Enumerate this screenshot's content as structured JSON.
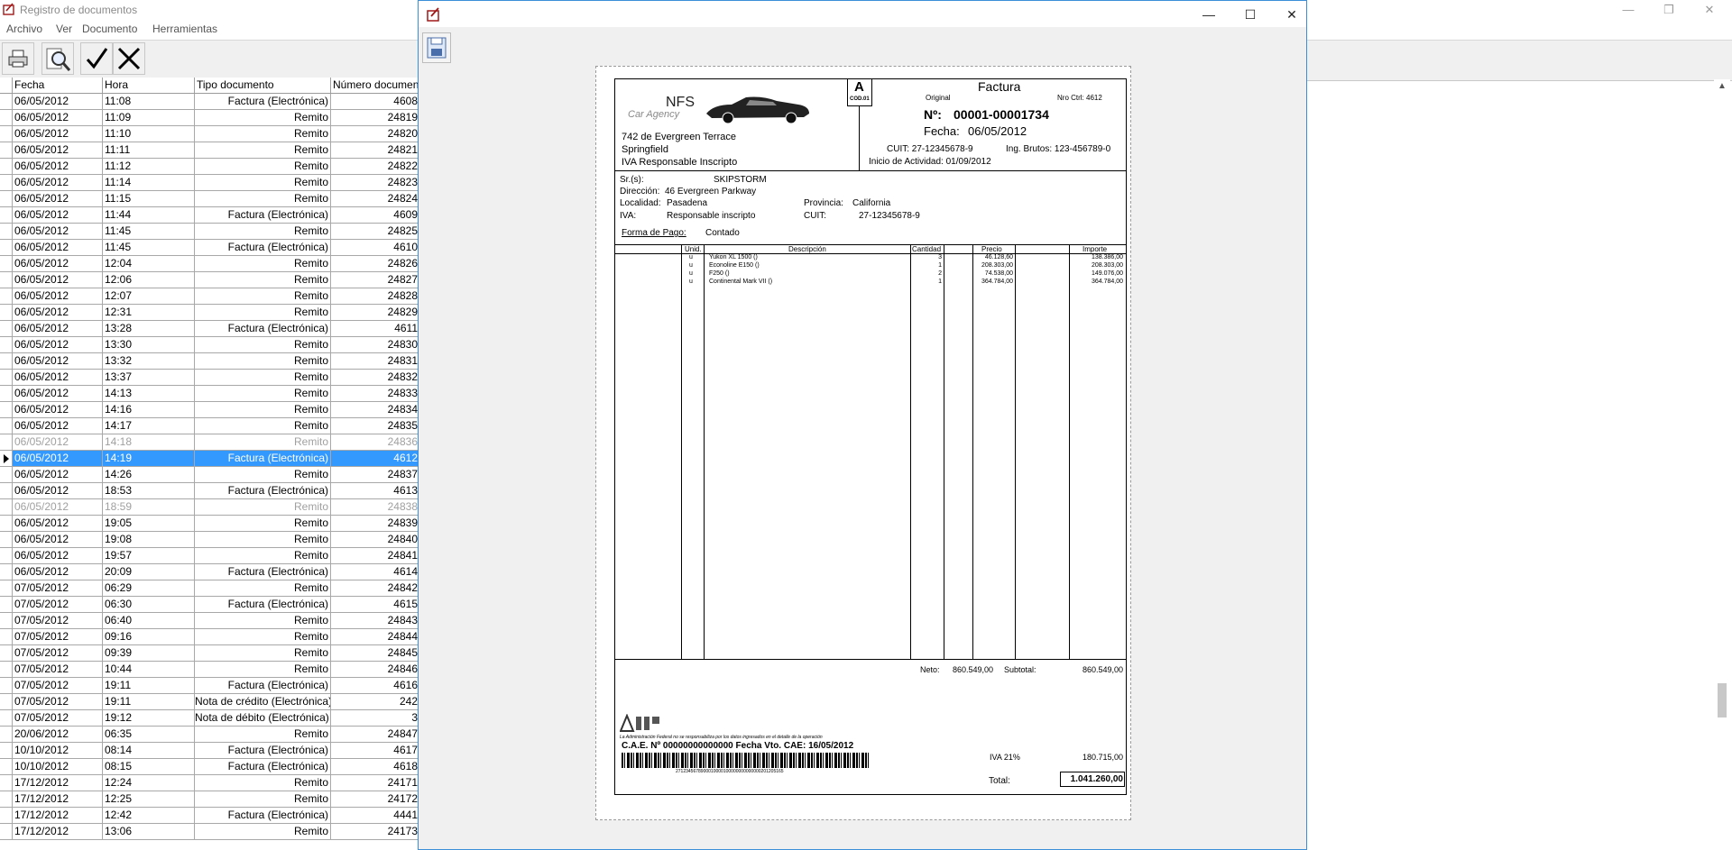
{
  "app": {
    "title": "Registro de documentos",
    "menu": [
      "Archivo",
      "Ver",
      "Documento",
      "Herramientas"
    ],
    "toolbar": [
      "printer-icon",
      "search-icon",
      "check-icon",
      "close-x-icon"
    ],
    "window_controls": [
      "—",
      "❐",
      "✕"
    ]
  },
  "grid": {
    "columns": [
      "Fecha",
      "Hora",
      "Tipo documento",
      "Número documento"
    ],
    "rows": [
      {
        "fecha": "06/05/2012",
        "hora": "11:08",
        "tipo": "Factura (Electrónica)",
        "num": "4608"
      },
      {
        "fecha": "06/05/2012",
        "hora": "11:09",
        "tipo": "Remito",
        "num": "24819"
      },
      {
        "fecha": "06/05/2012",
        "hora": "11:10",
        "tipo": "Remito",
        "num": "24820"
      },
      {
        "fecha": "06/05/2012",
        "hora": "11:11",
        "tipo": "Remito",
        "num": "24821"
      },
      {
        "fecha": "06/05/2012",
        "hora": "11:12",
        "tipo": "Remito",
        "num": "24822"
      },
      {
        "fecha": "06/05/2012",
        "hora": "11:14",
        "tipo": "Remito",
        "num": "24823"
      },
      {
        "fecha": "06/05/2012",
        "hora": "11:15",
        "tipo": "Remito",
        "num": "24824"
      },
      {
        "fecha": "06/05/2012",
        "hora": "11:44",
        "tipo": "Factura (Electrónica)",
        "num": "4609"
      },
      {
        "fecha": "06/05/2012",
        "hora": "11:45",
        "tipo": "Remito",
        "num": "24825"
      },
      {
        "fecha": "06/05/2012",
        "hora": "11:45",
        "tipo": "Factura (Electrónica)",
        "num": "4610"
      },
      {
        "fecha": "06/05/2012",
        "hora": "12:04",
        "tipo": "Remito",
        "num": "24826"
      },
      {
        "fecha": "06/05/2012",
        "hora": "12:06",
        "tipo": "Remito",
        "num": "24827"
      },
      {
        "fecha": "06/05/2012",
        "hora": "12:07",
        "tipo": "Remito",
        "num": "24828"
      },
      {
        "fecha": "06/05/2012",
        "hora": "12:31",
        "tipo": "Remito",
        "num": "24829"
      },
      {
        "fecha": "06/05/2012",
        "hora": "13:28",
        "tipo": "Factura (Electrónica)",
        "num": "4611"
      },
      {
        "fecha": "06/05/2012",
        "hora": "13:30",
        "tipo": "Remito",
        "num": "24830"
      },
      {
        "fecha": "06/05/2012",
        "hora": "13:32",
        "tipo": "Remito",
        "num": "24831"
      },
      {
        "fecha": "06/05/2012",
        "hora": "13:37",
        "tipo": "Remito",
        "num": "24832"
      },
      {
        "fecha": "06/05/2012",
        "hora": "14:13",
        "tipo": "Remito",
        "num": "24833"
      },
      {
        "fecha": "06/05/2012",
        "hora": "14:16",
        "tipo": "Remito",
        "num": "24834"
      },
      {
        "fecha": "06/05/2012",
        "hora": "14:17",
        "tipo": "Remito",
        "num": "24835"
      },
      {
        "fecha": "06/05/2012",
        "hora": "14:18",
        "tipo": "Remito",
        "num": "24836",
        "state": "dim"
      },
      {
        "fecha": "06/05/2012",
        "hora": "14:19",
        "tipo": "Factura (Electrónica)",
        "num": "4612",
        "state": "sel"
      },
      {
        "fecha": "06/05/2012",
        "hora": "14:26",
        "tipo": "Remito",
        "num": "24837"
      },
      {
        "fecha": "06/05/2012",
        "hora": "18:53",
        "tipo": "Factura (Electrónica)",
        "num": "4613"
      },
      {
        "fecha": "06/05/2012",
        "hora": "18:59",
        "tipo": "Remito",
        "num": "24838",
        "state": "dim"
      },
      {
        "fecha": "06/05/2012",
        "hora": "19:05",
        "tipo": "Remito",
        "num": "24839"
      },
      {
        "fecha": "06/05/2012",
        "hora": "19:08",
        "tipo": "Remito",
        "num": "24840"
      },
      {
        "fecha": "06/05/2012",
        "hora": "19:57",
        "tipo": "Remito",
        "num": "24841"
      },
      {
        "fecha": "06/05/2012",
        "hora": "20:09",
        "tipo": "Factura (Electrónica)",
        "num": "4614"
      },
      {
        "fecha": "07/05/2012",
        "hora": "06:29",
        "tipo": "Remito",
        "num": "24842"
      },
      {
        "fecha": "07/05/2012",
        "hora": "06:30",
        "tipo": "Factura (Electrónica)",
        "num": "4615"
      },
      {
        "fecha": "07/05/2012",
        "hora": "06:40",
        "tipo": "Remito",
        "num": "24843"
      },
      {
        "fecha": "07/05/2012",
        "hora": "09:16",
        "tipo": "Remito",
        "num": "24844"
      },
      {
        "fecha": "07/05/2012",
        "hora": "09:39",
        "tipo": "Remito",
        "num": "24845"
      },
      {
        "fecha": "07/05/2012",
        "hora": "10:44",
        "tipo": "Remito",
        "num": "24846"
      },
      {
        "fecha": "07/05/2012",
        "hora": "19:11",
        "tipo": "Factura (Electrónica)",
        "num": "4616"
      },
      {
        "fecha": "07/05/2012",
        "hora": "19:11",
        "tipo": "Nota de crédito (Electrónica)",
        "num": "242"
      },
      {
        "fecha": "07/05/2012",
        "hora": "19:12",
        "tipo": "Nota de débito (Electrónica)",
        "num": "3"
      },
      {
        "fecha": "20/06/2012",
        "hora": "06:35",
        "tipo": "Remito",
        "num": "24847"
      },
      {
        "fecha": "10/10/2012",
        "hora": "08:14",
        "tipo": "Factura (Electrónica)",
        "num": "4617"
      },
      {
        "fecha": "10/10/2012",
        "hora": "08:15",
        "tipo": "Factura (Electrónica)",
        "num": "4618"
      },
      {
        "fecha": "17/12/2012",
        "hora": "12:24",
        "tipo": "Remito",
        "num": "24171"
      },
      {
        "fecha": "17/12/2012",
        "hora": "12:25",
        "tipo": "Remito",
        "num": "24172"
      },
      {
        "fecha": "17/12/2012",
        "hora": "12:42",
        "tipo": "Factura (Electrónica)",
        "num": "4441"
      },
      {
        "fecha": "17/12/2012",
        "hora": "13:06",
        "tipo": "Remito",
        "num": "24173"
      }
    ]
  },
  "preview": {
    "window_controls": [
      "—",
      "☐",
      "✕"
    ],
    "invoice": {
      "letter": "A",
      "cod": "COD.01",
      "logo_text": "NFS",
      "logo_sub": "Car Agency",
      "title": "Factura",
      "original": "Original",
      "nro_ctrl": "Nro Ctrl: 4612",
      "numero_label": "Nº:",
      "numero": "00001-00001734",
      "fecha_label": "Fecha:",
      "fecha": "06/05/2012",
      "address1": "742 de Evergreen Terrace",
      "address2": "Springfield",
      "address3": "IVA Responsable Inscripto",
      "cuit": "CUIT: 27-12345678-9",
      "ing_brutos": "Ing. Brutos: 123-456789-0",
      "inicio": "Inicio de Actividad: 01/09/2012",
      "cliente_label": "Sr.(s):",
      "cliente": "SKIPSTORM",
      "direccion_label": "Dirección:",
      "direccion": "46 Evergreen Parkway",
      "localidad_label": "Localidad:",
      "localidad": "Pasadena",
      "provincia_label": "Provincia:",
      "provincia": "California",
      "iva_label": "IVA:",
      "iva": "Responsable inscripto",
      "cuit_label": "CUIT:",
      "cuit_cliente": "27-12345678-9",
      "pago_label": "Forma de Pago:",
      "pago": "Contado",
      "cols": [
        "Unid.",
        "Descripción",
        "Cantidad",
        "Precio",
        "Importe"
      ],
      "items": [
        {
          "unid": "u",
          "desc": "Yukon XL 1500 ()",
          "cant": "3",
          "precio": "46.128,60",
          "importe": "138.386,00"
        },
        {
          "unid": "u",
          "desc": "Econoline E150 ()",
          "cant": "1",
          "precio": "208.303,00",
          "importe": "208.303,00"
        },
        {
          "unid": "u",
          "desc": "F250 ()",
          "cant": "2",
          "precio": "74.538,00",
          "importe": "149.076,00"
        },
        {
          "unid": "u",
          "desc": "Continental Mark VII ()",
          "cant": "1",
          "precio": "364.784,00",
          "importe": "364.784,00"
        }
      ],
      "neto_label": "Neto:",
      "neto": "860.549,00",
      "subtotal_label": "Subtotal:",
      "subtotal": "860.549,00",
      "iva21_label": "IVA 21%",
      "iva21": "180.715,00",
      "total_label": "Total:",
      "total": "1.041.260,00",
      "afip_logo": "AFIP",
      "afip_note": "La Administración Federal no se responsabiliza por los datos ingresados en el detalle de la operación",
      "cae": "C.A.E. Nº  00000000000000  Fecha Vto. CAE: 16/05/2012",
      "barcode_digits": "2712345678900010000100000000000000201205165"
    }
  }
}
